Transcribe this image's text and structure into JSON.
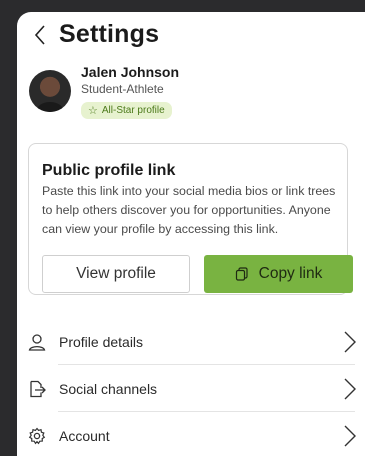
{
  "header": {
    "title": "Settings",
    "back_icon": "chevron-left-icon"
  },
  "profile": {
    "name": "Jalen Johnson",
    "role": "Student-Athlete",
    "badge": "All-Star profile",
    "badge_icon": "star-icon"
  },
  "public_link_card": {
    "title": "Public profile link",
    "description": "Paste this link into your social media bios or link trees to help others discover you for opportunities. Anyone can view your profile by accessing this link.",
    "view_button": "View profile",
    "copy_button": "Copy link",
    "copy_icon": "copy-icon"
  },
  "menu": {
    "items": [
      {
        "label": "Profile details",
        "icon": "person-icon"
      },
      {
        "label": "Social channels",
        "icon": "share-icon"
      },
      {
        "label": "Account",
        "icon": "gear-icon"
      }
    ]
  },
  "colors": {
    "accent_green": "#79b341",
    "badge_bg": "#e7f2cf",
    "badge_text": "#4c7a1a",
    "backdrop": "#2b2b2d"
  }
}
